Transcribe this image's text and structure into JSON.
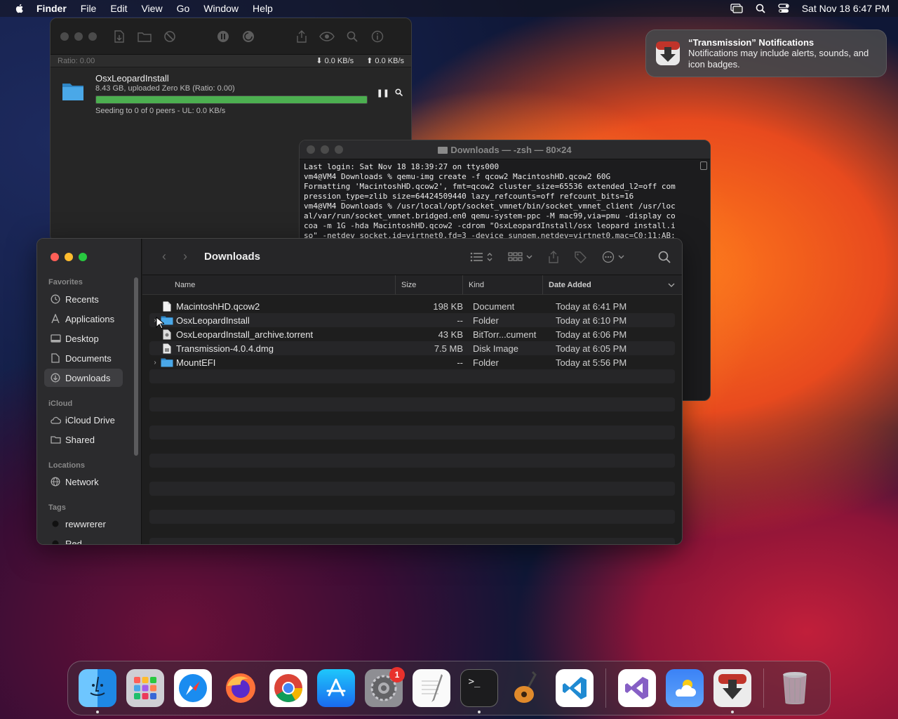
{
  "menubar": {
    "app": "Finder",
    "items": [
      "File",
      "Edit",
      "View",
      "Go",
      "Window",
      "Help"
    ],
    "clock": "Sat Nov 18  6:47 PM"
  },
  "notification": {
    "title": "“Transmission” Notifications",
    "body": "Notifications may include alerts, sounds, and icon badges."
  },
  "transmission": {
    "ratio": "Ratio: 0.00",
    "down_rate": "0.0 KB/s",
    "up_rate": "0.0 KB/s",
    "torrent": {
      "name": "OsxLeopardInstall",
      "stats": "8.43 GB, uploaded Zero KB (Ratio: 0.00)",
      "progress": 1.0,
      "status": "Seeding to 0 of 0 peers - UL: 0.0 KB/s"
    }
  },
  "terminal": {
    "title": "Downloads — -zsh — 80×24",
    "lines": [
      "Last login: Sat Nov 18 18:39:27 on ttys000",
      "vm4@VM4 Downloads % qemu-img create -f qcow2 MacintoshHD.qcow2 60G",
      "Formatting 'MacintoshHD.qcow2', fmt=qcow2 cluster_size=65536 extended_l2=off com",
      "pression_type=zlib size=64424509440 lazy_refcounts=off refcount_bits=16",
      "vm4@VM4 Downloads % /usr/local/opt/socket_vmnet/bin/socket_vmnet_client /usr/loc",
      "al/var/run/socket_vmnet.bridged.en0 qemu-system-ppc -M mac99,via=pmu -display co",
      "coa -m 1G -hda MacintoshHD.qcow2 -cdrom \"OsxLeopardInstall/osx leopard install.i",
      "so\" -netdev socket,id=virtnet0,fd=3 -device sungem,netdev=virtnet0,mac=C0:11:AB:"
    ]
  },
  "finder": {
    "title": "Downloads",
    "sidebar": {
      "favorites_label": "Favorites",
      "favorites": [
        "Recents",
        "Applications",
        "Desktop",
        "Documents",
        "Downloads"
      ],
      "icloud_label": "iCloud",
      "icloud": [
        "iCloud Drive",
        "Shared"
      ],
      "locations_label": "Locations",
      "locations": [
        "Network"
      ],
      "tags_label": "Tags",
      "tags": [
        "rewwrerer",
        "Red"
      ]
    },
    "columns": {
      "name": "Name",
      "size": "Size",
      "kind": "Kind",
      "date": "Date Added"
    },
    "files": [
      {
        "name": "MacintoshHD.qcow2",
        "size": "198 KB",
        "kind": "Document",
        "date": "Today at 6:41 PM",
        "icon": "document-icon"
      },
      {
        "name": "OsxLeopardInstall",
        "size": "--",
        "kind": "Folder",
        "date": "Today at 6:10 PM",
        "icon": "folder-icon"
      },
      {
        "name": "OsxLeopardInstall_archive.torrent",
        "size": "43 KB",
        "kind": "BitTorr...cument",
        "date": "Today at 6:06 PM",
        "icon": "torrent-file-icon"
      },
      {
        "name": "Transmission-4.0.4.dmg",
        "size": "7.5 MB",
        "kind": "Disk Image",
        "date": "Today at 6:05 PM",
        "icon": "disk-image-icon"
      },
      {
        "name": "MountEFI",
        "size": "--",
        "kind": "Folder",
        "date": "Today at 5:56 PM",
        "icon": "folder-icon"
      }
    ]
  },
  "dock": {
    "settings_badge": "1",
    "apps": [
      "finder-icon",
      "launchpad-icon",
      "safari-icon",
      "firefox-icon",
      "chrome-icon",
      "app-store-icon",
      "system-settings-icon",
      "textedit-icon",
      "terminal-icon",
      "garageband-icon",
      "vscode-icon",
      "visual-studio-icon",
      "weather-icon",
      "transmission-icon",
      "trash-icon"
    ]
  },
  "colors": {
    "traffic_close": "#ff5f57",
    "traffic_min": "#febc2e",
    "traffic_max": "#28c840",
    "progress_fill": "#4caf50",
    "folder_blue": "#4aa8e8"
  }
}
